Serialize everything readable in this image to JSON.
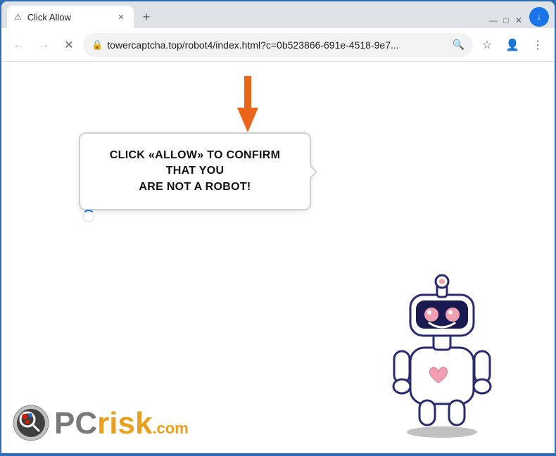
{
  "browser": {
    "window_controls": {
      "minimize": "—",
      "maximize": "□",
      "close": "✕"
    },
    "tab": {
      "title": "Click Allow",
      "favicon": "⚠",
      "close_label": "✕"
    },
    "new_tab_label": "+",
    "extension_label": "↓",
    "nav": {
      "back_label": "←",
      "forward_label": "→",
      "reload_label": "✕"
    },
    "address_bar": {
      "lock_icon": "🔒",
      "url": "towercaptcha.top/robot4/index.html?c=0b523866-691e-4518-9e7...",
      "search_icon": "🔍"
    },
    "toolbar": {
      "bookmark_label": "☆",
      "profile_label": "👤",
      "menu_label": "⋮"
    }
  },
  "page": {
    "speech_bubble": {
      "line1": "CLICK «ALLOW» TO CONFIRM THAT YOU",
      "line2": "ARE NOT A ROBOT!",
      "full_text": "CLICK «ALLOW» TO CONFIRM THAT YOU ARE NOT A ROBOT!"
    }
  },
  "pcrisk": {
    "pc_text": "PC",
    "risk_text": "risk",
    "com_text": ".com"
  },
  "colors": {
    "orange_arrow": "#e8651a",
    "brand_blue": "#2d6db5",
    "accent_blue": "#1a73e8"
  }
}
